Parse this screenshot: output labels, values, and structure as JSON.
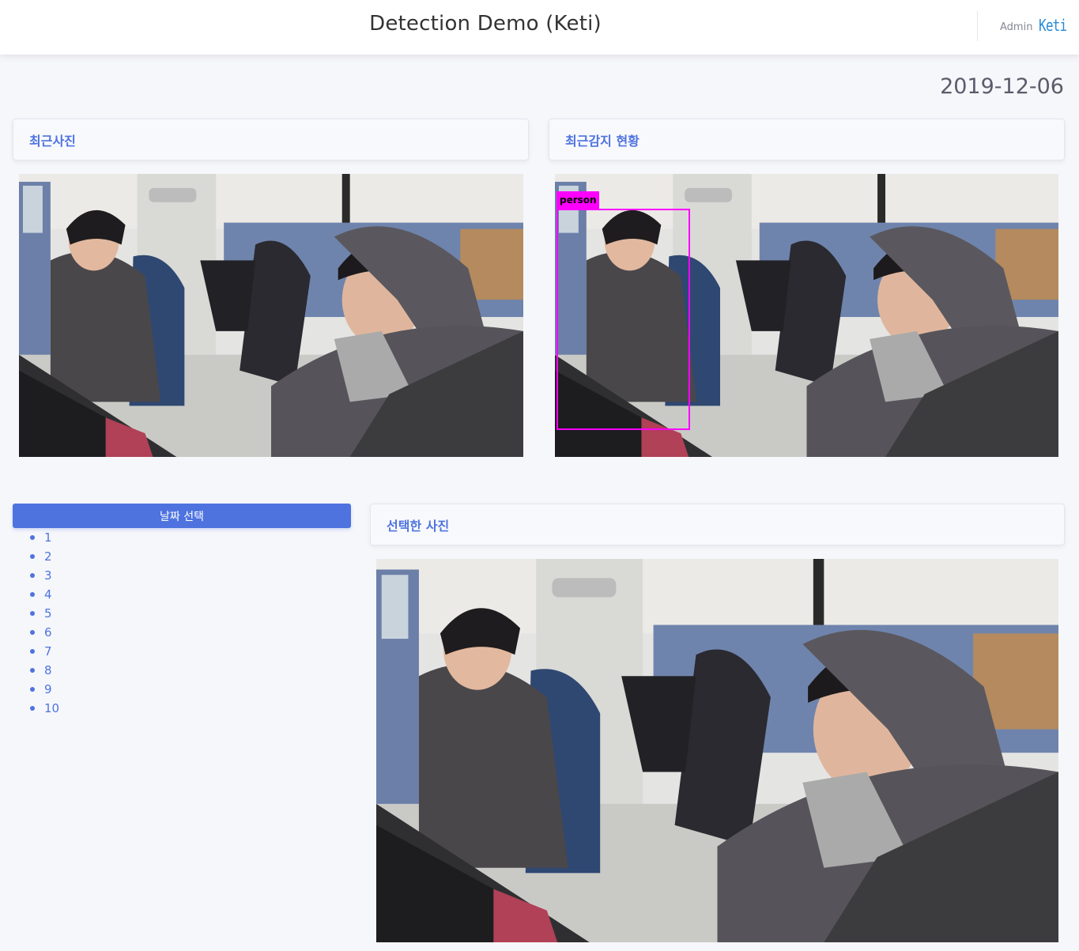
{
  "header": {
    "title": "Detection Demo (Keti)",
    "user": "Admin",
    "logo_text": "Keti"
  },
  "date": "2019-12-06",
  "cards": {
    "recent_photo": "최근사진",
    "recent_detection": "최근감지 현황",
    "selected_photo": "선택한 사진"
  },
  "detection": {
    "label": "person",
    "box_color": "#ff00ff"
  },
  "date_select": {
    "button_label": "날짜 선택",
    "items": [
      "1",
      "2",
      "3",
      "4",
      "5",
      "6",
      "7",
      "8",
      "9",
      "10"
    ]
  },
  "colors": {
    "accent": "#4e73df",
    "background": "#f6f7fb"
  }
}
